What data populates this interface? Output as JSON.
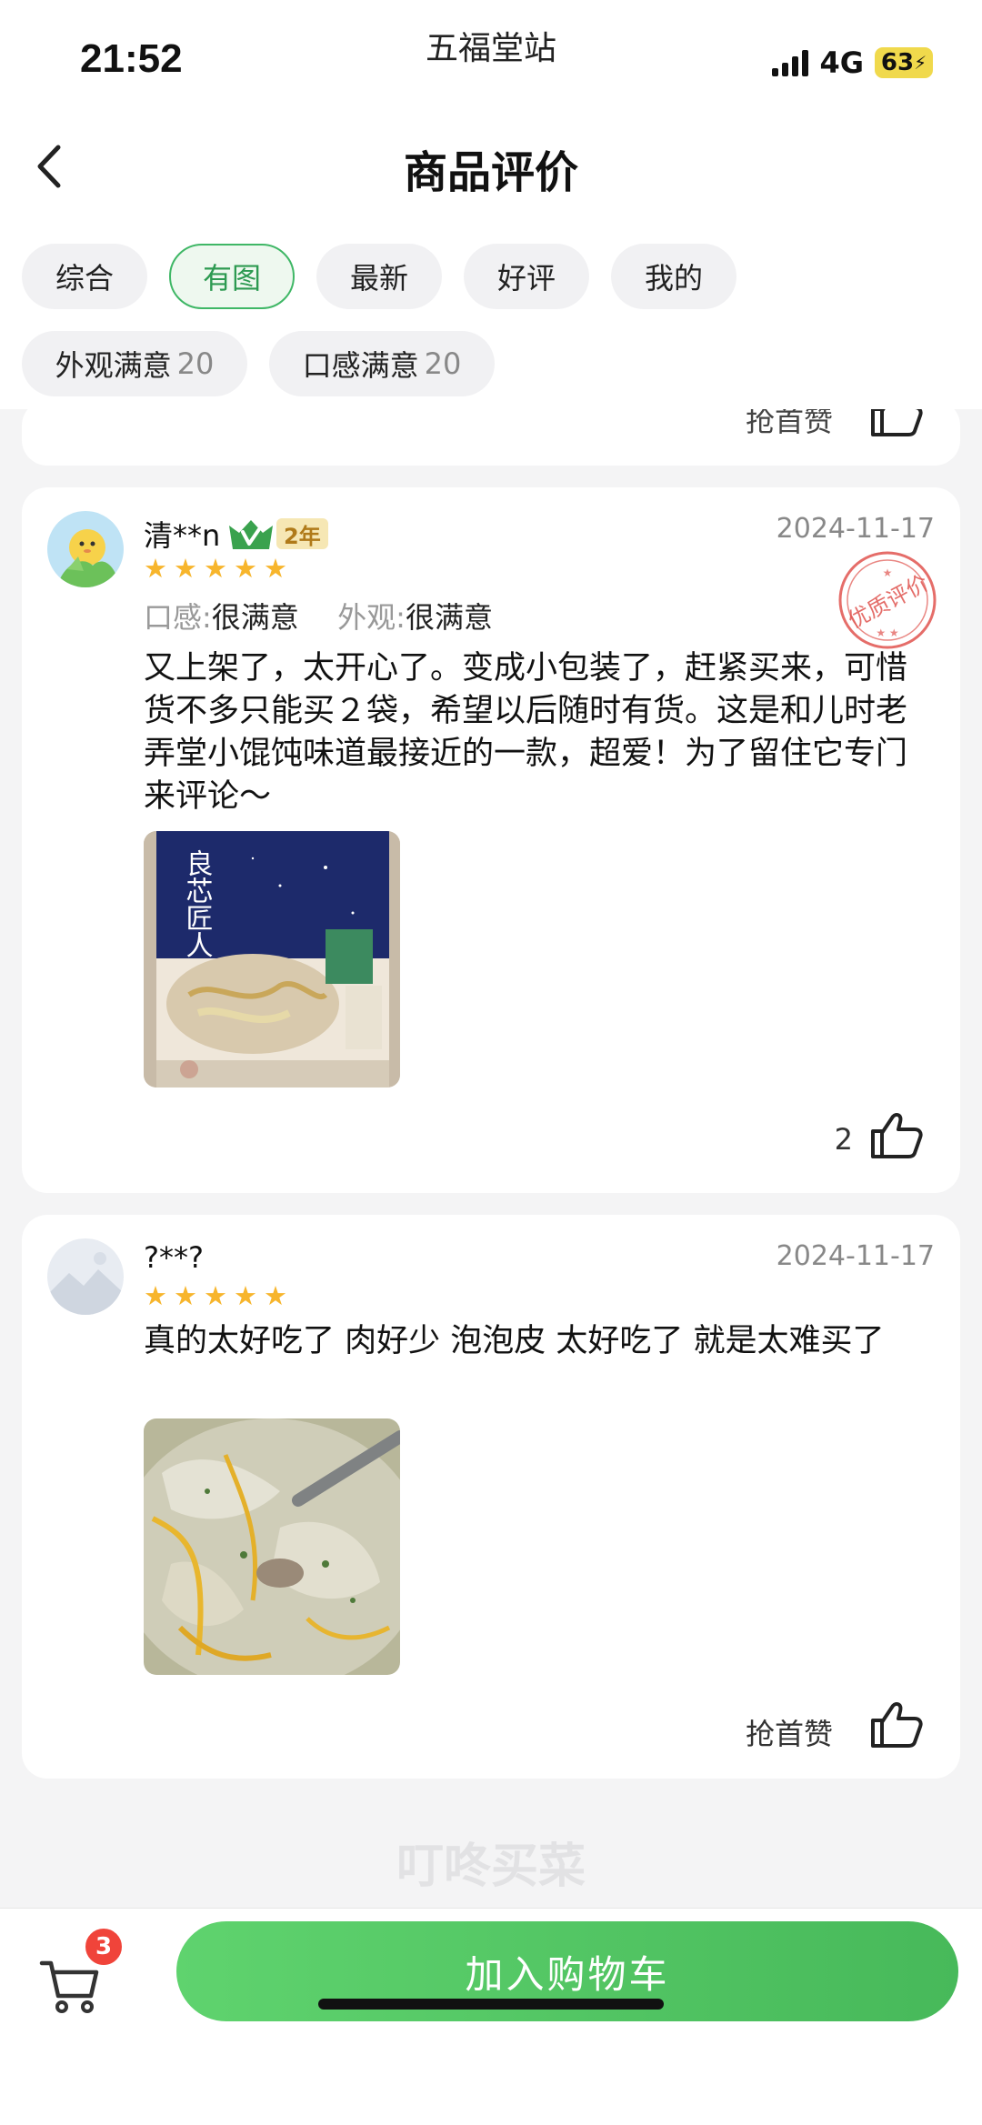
{
  "status_bar": {
    "time": "21:52",
    "station": "五福堂站",
    "network": "4G",
    "battery": "63"
  },
  "header": {
    "title": "商品评价"
  },
  "filters": {
    "primary": [
      {
        "label": "综合",
        "active": false
      },
      {
        "label": "有图",
        "active": true
      },
      {
        "label": "最新",
        "active": false
      },
      {
        "label": "好评",
        "active": false
      },
      {
        "label": "我的",
        "active": false
      }
    ],
    "tags": [
      {
        "label": "外观满意",
        "count": "20"
      },
      {
        "label": "口感满意",
        "count": "20"
      }
    ]
  },
  "reviews": [
    {
      "user": "清**n",
      "badge": "2年",
      "date": "2024-11-17",
      "stars": 5,
      "seal": "优质评价",
      "attributes": [
        {
          "key": "口感:",
          "value": "很满意"
        },
        {
          "key": "外观:",
          "value": "很满意"
        }
      ],
      "text": "又上架了，太开心了。变成小包装了，赶紧买来，可惜货不多只能买２袋，希望以后随时有货。这是和儿时老弄堂小馄饨味道最接近的一款，超爱！为了留住它专门来评论～",
      "package_text": "良芯匠人",
      "likes": "2"
    },
    {
      "user": "?**?",
      "date": "2024-11-17",
      "stars": 5,
      "text": "真的太好吃了 肉好少 泡泡皮 太好吃了 就是太难买了",
      "like_label": "抢首赞"
    }
  ],
  "previous_card": {
    "like_label": "抢首赞"
  },
  "watermark": "叮咚买菜",
  "bottom_bar": {
    "cart_count": "3",
    "add_to_cart": "加入购物车"
  },
  "colors": {
    "accent": "#47b95a",
    "star": "#f7b52c",
    "badge_red": "#f0443a",
    "seal_red": "#e0544f"
  },
  "icons": [
    "back-arrow-icon",
    "crown-v-icon",
    "star-icon",
    "thumbs-up-icon",
    "cart-icon"
  ]
}
